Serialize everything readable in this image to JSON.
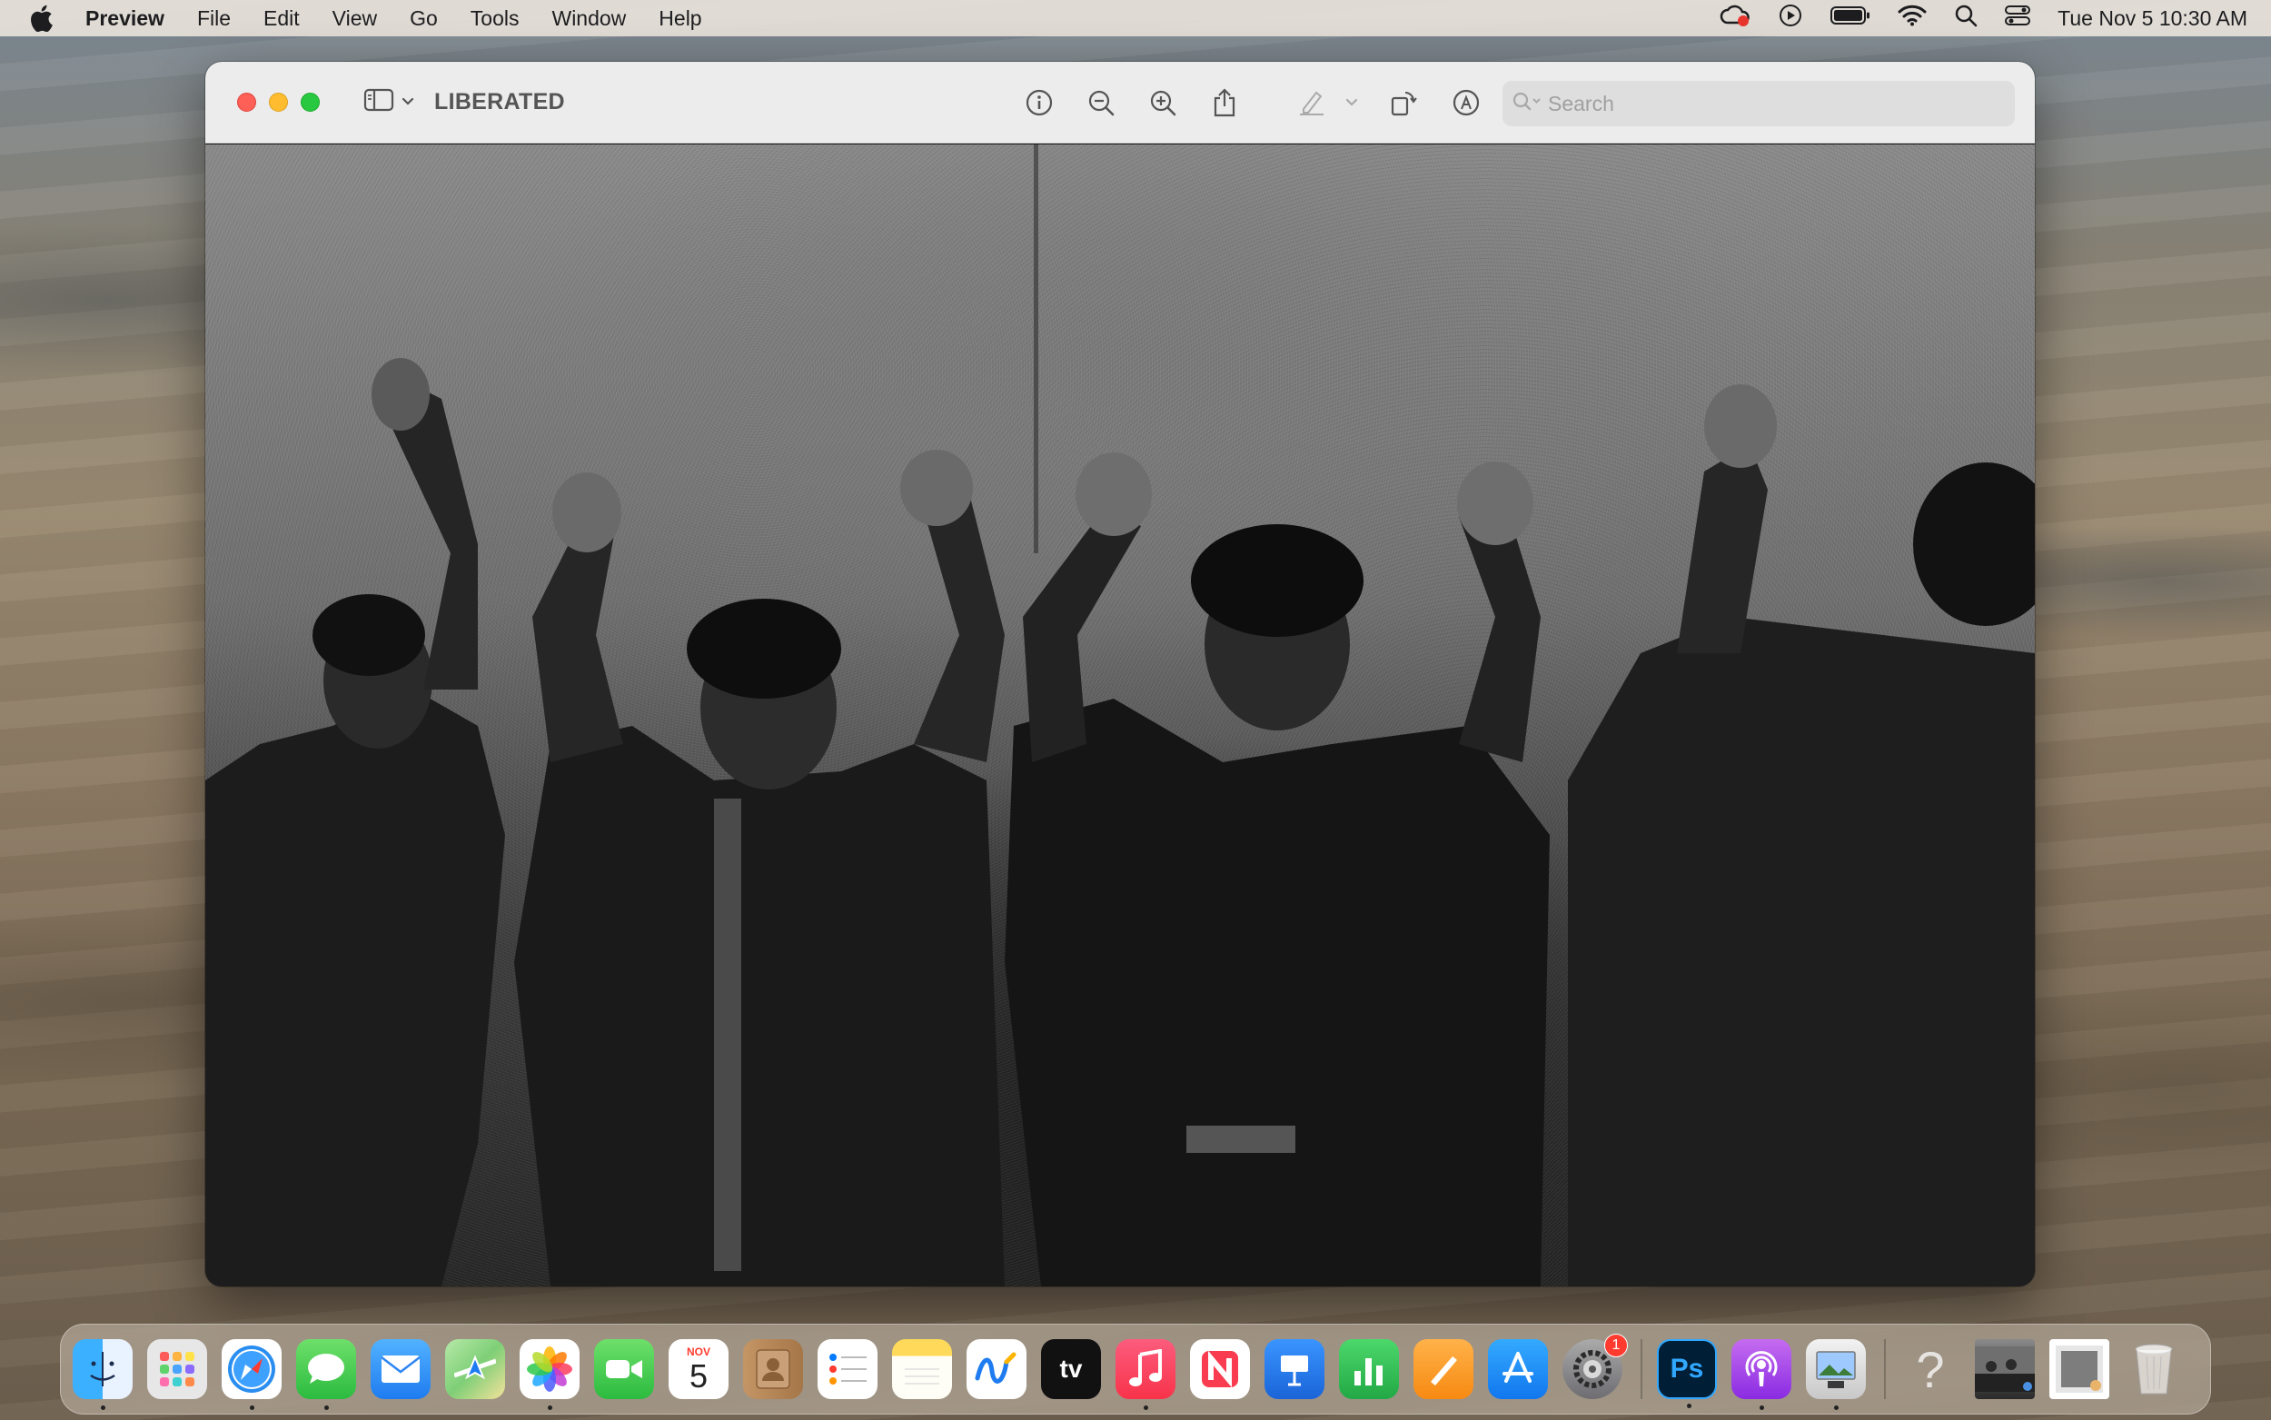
{
  "menubar": {
    "app_name": "Preview",
    "menus": [
      "File",
      "Edit",
      "View",
      "Go",
      "Tools",
      "Window",
      "Help"
    ],
    "clock": "Tue Nov 5  10:30 AM"
  },
  "window": {
    "title": "LIBERATED",
    "search": {
      "placeholder": "Search",
      "value": ""
    },
    "toolbar_icons": [
      "info-icon",
      "zoom-out-icon",
      "zoom-in-icon",
      "share-icon",
      "highlight-icon",
      "rotate-icon",
      "markup-icon"
    ]
  },
  "dock": {
    "apps": [
      {
        "name": "Finder",
        "color": "#1e88f5",
        "running": true
      },
      {
        "name": "Launchpad",
        "color": "#e8e8e8",
        "running": false
      },
      {
        "name": "Safari",
        "color": "#2a8df0",
        "running": true
      },
      {
        "name": "Messages",
        "color": "#34c759",
        "running": true
      },
      {
        "name": "Mail",
        "color": "#2f86f2",
        "running": false
      },
      {
        "name": "Maps",
        "color": "#6cc46a",
        "running": false
      },
      {
        "name": "Photos",
        "color": "#f4f4f4",
        "running": true
      },
      {
        "name": "FaceTime",
        "color": "#34c759",
        "running": false
      },
      {
        "name": "Calendar",
        "color": "#ffffff",
        "running": false,
        "month": "NOV",
        "day": "5"
      },
      {
        "name": "Contacts",
        "color": "#b8895a",
        "running": false
      },
      {
        "name": "Reminders",
        "color": "#ffffff",
        "running": false
      },
      {
        "name": "Notes",
        "color": "#ffd95a",
        "running": false
      },
      {
        "name": "Freeform",
        "color": "#ffffff",
        "running": false
      },
      {
        "name": "TV",
        "color": "#111111",
        "running": false,
        "label": "tv"
      },
      {
        "name": "Music",
        "color": "#fa3c50",
        "running": true
      },
      {
        "name": "News",
        "color": "#ffffff",
        "running": false
      },
      {
        "name": "Keynote",
        "color": "#2b7cf1",
        "running": false
      },
      {
        "name": "Numbers",
        "color": "#30c254",
        "running": false
      },
      {
        "name": "Pages",
        "color": "#f79a25",
        "running": false
      },
      {
        "name": "App Store",
        "color": "#1f8ef1",
        "running": false
      },
      {
        "name": "System Settings",
        "color": "#8e8e93",
        "running": false,
        "badge": "1"
      }
    ],
    "recent": [
      {
        "name": "Photoshop",
        "color": "#0b1f3a",
        "running": true,
        "label": "Ps"
      },
      {
        "name": "Podcasts",
        "color": "#9b3cd6",
        "running": true
      },
      {
        "name": "Preview",
        "color": "#d9d9d9",
        "running": true
      }
    ],
    "others": [
      {
        "name": "Help"
      },
      {
        "name": "Stack Photos"
      },
      {
        "name": "Stack Images"
      },
      {
        "name": "Trash"
      }
    ]
  }
}
